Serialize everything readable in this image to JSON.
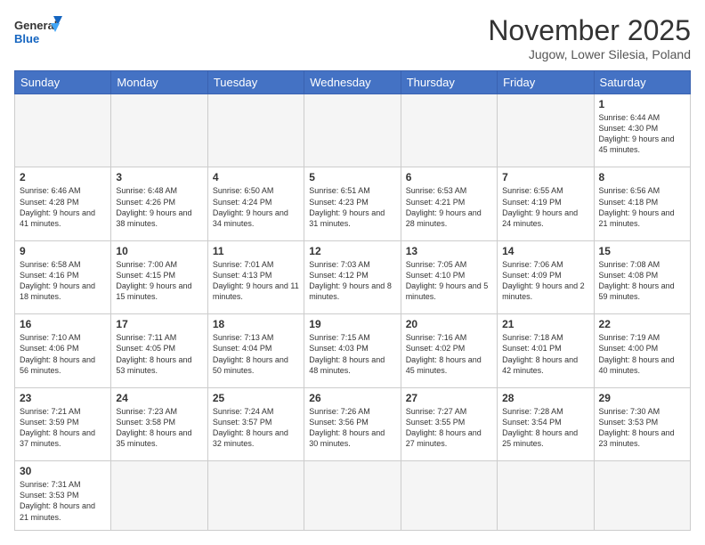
{
  "header": {
    "logo_general": "General",
    "logo_blue": "Blue",
    "month_title": "November 2025",
    "subtitle": "Jugow, Lower Silesia, Poland"
  },
  "weekdays": [
    "Sunday",
    "Monday",
    "Tuesday",
    "Wednesday",
    "Thursday",
    "Friday",
    "Saturday"
  ],
  "weeks": [
    [
      {
        "day": "",
        "info": ""
      },
      {
        "day": "",
        "info": ""
      },
      {
        "day": "",
        "info": ""
      },
      {
        "day": "",
        "info": ""
      },
      {
        "day": "",
        "info": ""
      },
      {
        "day": "",
        "info": ""
      },
      {
        "day": "1",
        "info": "Sunrise: 6:44 AM\nSunset: 4:30 PM\nDaylight: 9 hours\nand 45 minutes."
      }
    ],
    [
      {
        "day": "2",
        "info": "Sunrise: 6:46 AM\nSunset: 4:28 PM\nDaylight: 9 hours\nand 41 minutes."
      },
      {
        "day": "3",
        "info": "Sunrise: 6:48 AM\nSunset: 4:26 PM\nDaylight: 9 hours\nand 38 minutes."
      },
      {
        "day": "4",
        "info": "Sunrise: 6:50 AM\nSunset: 4:24 PM\nDaylight: 9 hours\nand 34 minutes."
      },
      {
        "day": "5",
        "info": "Sunrise: 6:51 AM\nSunset: 4:23 PM\nDaylight: 9 hours\nand 31 minutes."
      },
      {
        "day": "6",
        "info": "Sunrise: 6:53 AM\nSunset: 4:21 PM\nDaylight: 9 hours\nand 28 minutes."
      },
      {
        "day": "7",
        "info": "Sunrise: 6:55 AM\nSunset: 4:19 PM\nDaylight: 9 hours\nand 24 minutes."
      },
      {
        "day": "8",
        "info": "Sunrise: 6:56 AM\nSunset: 4:18 PM\nDaylight: 9 hours\nand 21 minutes."
      }
    ],
    [
      {
        "day": "9",
        "info": "Sunrise: 6:58 AM\nSunset: 4:16 PM\nDaylight: 9 hours\nand 18 minutes."
      },
      {
        "day": "10",
        "info": "Sunrise: 7:00 AM\nSunset: 4:15 PM\nDaylight: 9 hours\nand 15 minutes."
      },
      {
        "day": "11",
        "info": "Sunrise: 7:01 AM\nSunset: 4:13 PM\nDaylight: 9 hours\nand 11 minutes."
      },
      {
        "day": "12",
        "info": "Sunrise: 7:03 AM\nSunset: 4:12 PM\nDaylight: 9 hours\nand 8 minutes."
      },
      {
        "day": "13",
        "info": "Sunrise: 7:05 AM\nSunset: 4:10 PM\nDaylight: 9 hours\nand 5 minutes."
      },
      {
        "day": "14",
        "info": "Sunrise: 7:06 AM\nSunset: 4:09 PM\nDaylight: 9 hours\nand 2 minutes."
      },
      {
        "day": "15",
        "info": "Sunrise: 7:08 AM\nSunset: 4:08 PM\nDaylight: 8 hours\nand 59 minutes."
      }
    ],
    [
      {
        "day": "16",
        "info": "Sunrise: 7:10 AM\nSunset: 4:06 PM\nDaylight: 8 hours\nand 56 minutes."
      },
      {
        "day": "17",
        "info": "Sunrise: 7:11 AM\nSunset: 4:05 PM\nDaylight: 8 hours\nand 53 minutes."
      },
      {
        "day": "18",
        "info": "Sunrise: 7:13 AM\nSunset: 4:04 PM\nDaylight: 8 hours\nand 50 minutes."
      },
      {
        "day": "19",
        "info": "Sunrise: 7:15 AM\nSunset: 4:03 PM\nDaylight: 8 hours\nand 48 minutes."
      },
      {
        "day": "20",
        "info": "Sunrise: 7:16 AM\nSunset: 4:02 PM\nDaylight: 8 hours\nand 45 minutes."
      },
      {
        "day": "21",
        "info": "Sunrise: 7:18 AM\nSunset: 4:01 PM\nDaylight: 8 hours\nand 42 minutes."
      },
      {
        "day": "22",
        "info": "Sunrise: 7:19 AM\nSunset: 4:00 PM\nDaylight: 8 hours\nand 40 minutes."
      }
    ],
    [
      {
        "day": "23",
        "info": "Sunrise: 7:21 AM\nSunset: 3:59 PM\nDaylight: 8 hours\nand 37 minutes."
      },
      {
        "day": "24",
        "info": "Sunrise: 7:23 AM\nSunset: 3:58 PM\nDaylight: 8 hours\nand 35 minutes."
      },
      {
        "day": "25",
        "info": "Sunrise: 7:24 AM\nSunset: 3:57 PM\nDaylight: 8 hours\nand 32 minutes."
      },
      {
        "day": "26",
        "info": "Sunrise: 7:26 AM\nSunset: 3:56 PM\nDaylight: 8 hours\nand 30 minutes."
      },
      {
        "day": "27",
        "info": "Sunrise: 7:27 AM\nSunset: 3:55 PM\nDaylight: 8 hours\nand 27 minutes."
      },
      {
        "day": "28",
        "info": "Sunrise: 7:28 AM\nSunset: 3:54 PM\nDaylight: 8 hours\nand 25 minutes."
      },
      {
        "day": "29",
        "info": "Sunrise: 7:30 AM\nSunset: 3:53 PM\nDaylight: 8 hours\nand 23 minutes."
      }
    ],
    [
      {
        "day": "30",
        "info": "Sunrise: 7:31 AM\nSunset: 3:53 PM\nDaylight: 8 hours\nand 21 minutes."
      },
      {
        "day": "",
        "info": ""
      },
      {
        "day": "",
        "info": ""
      },
      {
        "day": "",
        "info": ""
      },
      {
        "day": "",
        "info": ""
      },
      {
        "day": "",
        "info": ""
      },
      {
        "day": "",
        "info": ""
      }
    ]
  ]
}
